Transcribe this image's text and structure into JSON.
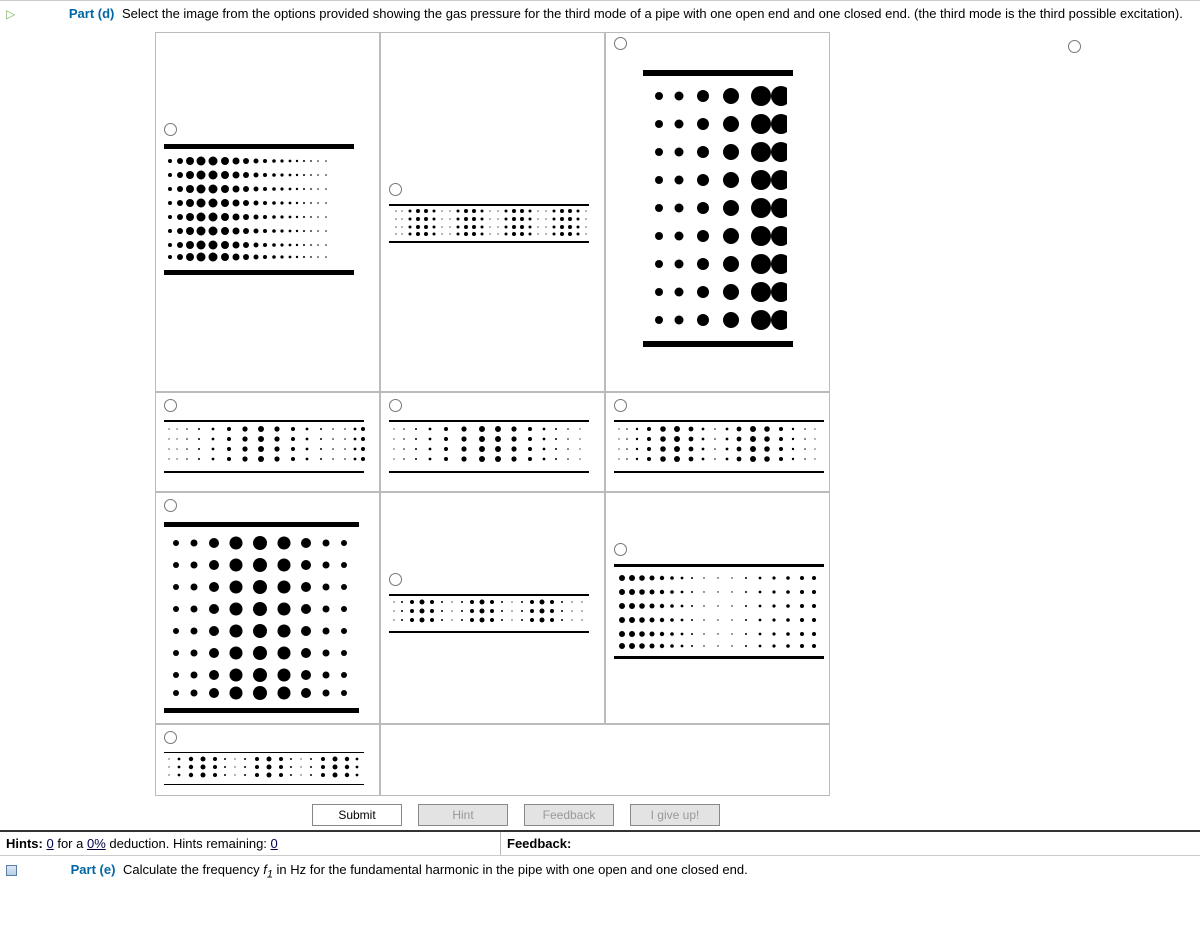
{
  "part_d": {
    "label": "Part (d)",
    "prompt": "Select the image from the options provided showing the gas pressure for the third mode of a pipe with one open end and one closed end. (the third mode is the third possible excitation)."
  },
  "options": {
    "count": 11
  },
  "buttons": {
    "submit": "Submit",
    "hint": "Hint",
    "feedback": "Feedback",
    "giveup": "I give up!"
  },
  "footer": {
    "hints_label": "Hints:",
    "hints_used": "0",
    "for_a": "for a",
    "deduction_pct": "0%",
    "deduction_word": "deduction. Hints remaining:",
    "hints_remaining": "0",
    "feedback_label": "Feedback:"
  },
  "part_e": {
    "label": "Part (e)",
    "prompt_pre": "Calculate the frequency ",
    "var": "f",
    "sub": "1",
    "prompt_post": " in Hz for the fundamental harmonic in the pipe with one open and one closed end."
  }
}
